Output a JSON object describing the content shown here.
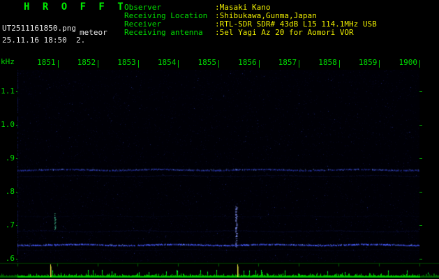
{
  "header": {
    "app_title": "H R O F F T",
    "filename": "UT2511161850.png",
    "mode": "meteor",
    "timestamp": "25.11.16 18:50  2.",
    "info": [
      {
        "label": "Observer",
        "value": ":Masaki Kano"
      },
      {
        "label": "Receiving Location",
        "value": ":Shibukawa,Gunma,Japan"
      },
      {
        "label": "Receiver",
        "value": ":RTL-SDR SDR# 43dB L15 114.1MHz USB"
      },
      {
        "label": "Receiving antenna",
        "value": ":5el Yagi Az 20 for Aomori VOR"
      }
    ]
  },
  "colors": {
    "accent_green": "#00dd00",
    "accent_yellow": "#eeee00",
    "text_white": "#e8e8e8",
    "band_blue": "#3040cc",
    "strong_band_blue": "#4458ff",
    "echo_cyan": "#50e8b0",
    "echo_blue": "#8898ff",
    "strip_green": "#00c800",
    "marker_yellow": "#e8e840"
  },
  "chart_data": {
    "type": "heatmap",
    "title": "HROFFT radio meteor spectrogram 18:50-19:00 UT",
    "ylabel": "kHz",
    "xlabel": "",
    "x_tick_labels": [
      "1851",
      "1852",
      "1853",
      "1854",
      "1855",
      "1856",
      "1857",
      "1858",
      "1859",
      "1900"
    ],
    "x_range_minutes": [
      0,
      10
    ],
    "y_tick_labels": [
      "1.1",
      "1.0",
      ".9",
      ".8",
      ".7",
      ".6"
    ],
    "y_tick_khz": [
      1.1,
      1.0,
      0.9,
      0.8,
      0.7,
      0.6
    ],
    "ylim_khz": [
      0.59,
      1.165
    ],
    "grid": false,
    "legend": "none",
    "bands": [
      {
        "khz": 0.867,
        "intensity": 0.75,
        "thickness": 2,
        "color": "#3040cc"
      },
      {
        "khz": 0.848,
        "intensity": 0.35,
        "thickness": 1,
        "color": "#202c96"
      },
      {
        "khz": 0.728,
        "intensity": 0.2,
        "thickness": 1,
        "color": "#1c2478"
      },
      {
        "khz": 0.683,
        "intensity": 0.3,
        "thickness": 1,
        "color": "#242ea0"
      },
      {
        "khz": 0.643,
        "intensity": 1.0,
        "thickness": 2,
        "color": "#4458ff"
      },
      {
        "khz": 0.627,
        "intensity": 0.25,
        "thickness": 1,
        "color": "#1c2478"
      }
    ],
    "events": [
      {
        "minute": 0.92,
        "khz_from": 0.685,
        "khz_to": 0.735,
        "color": "#50e8b0",
        "width": 2
      },
      {
        "minute": 5.42,
        "khz_from": 0.63,
        "khz_to": 0.755,
        "color": "#8898ff",
        "width": 3
      }
    ],
    "bottom_strip": {
      "baseline_color": "#00c800",
      "marker_color": "#e8e840",
      "markers_minute": [
        0.82,
        5.48
      ]
    }
  }
}
